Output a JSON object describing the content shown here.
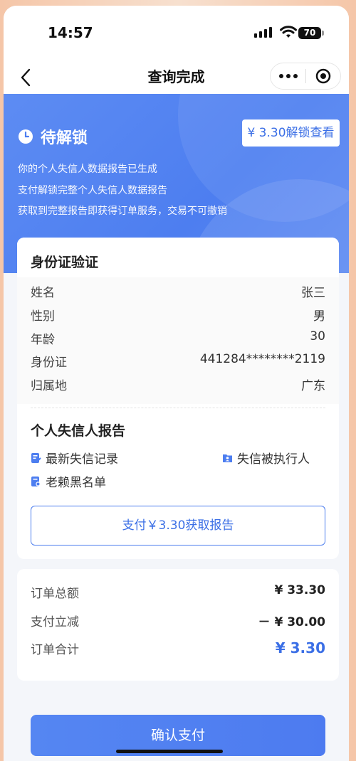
{
  "status_bar": {
    "time": "14:57",
    "battery": "70"
  },
  "nav": {
    "title": "查询完成"
  },
  "banner": {
    "status": "待解锁",
    "unlock_button": "¥ 3.30解锁查看",
    "lines": [
      "你的个人失信人数据报告已生成",
      "支付解锁完整个人失信人数据报告",
      "获取到完整报告即获得订单服务，交易不可撤销"
    ]
  },
  "id_section": {
    "title": "身份证验证",
    "rows": [
      {
        "label": "姓名",
        "value": "张三"
      },
      {
        "label": "性别",
        "value": "男"
      },
      {
        "label": "年龄",
        "value": "30"
      },
      {
        "label": "身份证",
        "value": "441284********2119"
      },
      {
        "label": "归属地",
        "value": "广东"
      }
    ]
  },
  "report_section": {
    "title": "个人失信人报告",
    "features": [
      "最新失信记录",
      "失信被执行人",
      "老赖黑名单"
    ],
    "pay_button": "支付￥3.30获取报告"
  },
  "order": {
    "total_label": "订单总额",
    "total_value": "¥ 33.30",
    "discount_label": "支付立减",
    "discount_value": "－ ¥ 30.00",
    "sum_label": "订单合计",
    "sum_value": "¥ 3.30"
  },
  "confirm_button": "确认支付",
  "colors": {
    "accent": "#4d7ef0",
    "accent_text": "#3b6fe6"
  }
}
